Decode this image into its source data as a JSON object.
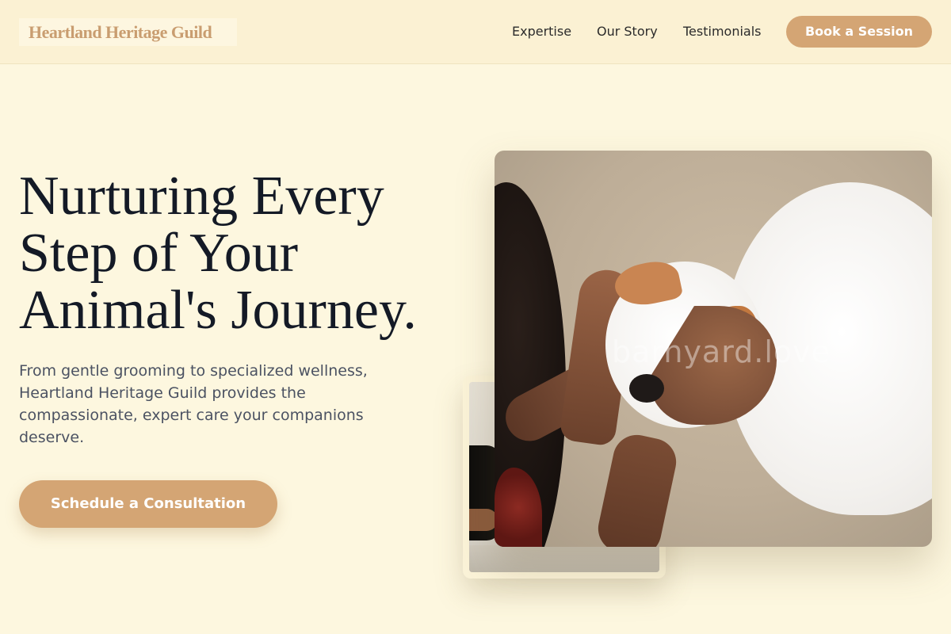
{
  "header": {
    "logo_text": "Heartland Heritage Guild",
    "nav": {
      "expertise": "Expertise",
      "our_story": "Our Story",
      "testimonials": "Testimonials"
    },
    "book_button": "Book a Session"
  },
  "hero": {
    "title": "Nurturing Every Step of Your Animal's Journey.",
    "subtitle": "From gentle grooming to specialized wellness, Heartland Heritage Guild provides the compassionate, expert care your companions deserve.",
    "cta_button": "Schedule a Consultation",
    "image_watermark": "barnyard.love"
  },
  "colors": {
    "background": "#fdf7df",
    "header_background": "#fbf1d3",
    "accent": "#d4a574",
    "logo": "#c99d70",
    "heading": "#141a26",
    "body_text": "#4b5262"
  }
}
